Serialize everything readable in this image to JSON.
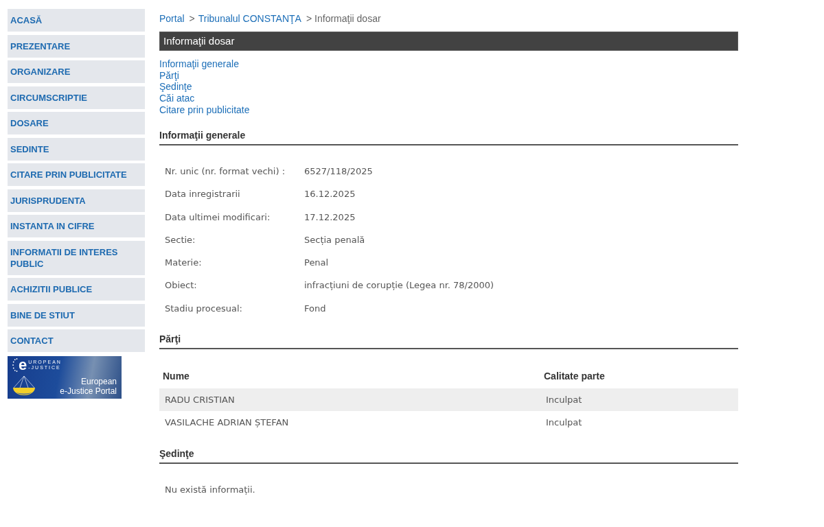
{
  "sidebar": {
    "items": [
      "ACASĂ",
      "PREZENTARE",
      "ORGANIZARE",
      "CIRCUMSCRIPTIE",
      "DOSARE",
      "SEDINTE",
      "CITARE PRIN PUBLICITATE",
      "JURISPRUDENTA",
      "INSTANTA IN CIFRE",
      "INFORMATII DE INTERES PUBLIC",
      "ACHIZITII PUBLICE",
      "BINE DE STIUT",
      "CONTACT"
    ],
    "banner": {
      "logo_letter": "e",
      "logo_top": "UROPEAN",
      "logo_bottom": "-JUSTICE",
      "caption": [
        "European",
        "e-Justice Portal"
      ]
    }
  },
  "breadcrumb": [
    {
      "label": "Portal",
      "link": true
    },
    {
      "separator": ">",
      "label": "Tribunalul CONSTANŢA",
      "link": true
    },
    {
      "separator": ">",
      "label": "Informaţii dosar",
      "link": false
    }
  ],
  "page_title": "Informaţii dosar",
  "section_links": [
    "Informaţii generale",
    "Părţi",
    "Şedinţe",
    "Căi atac",
    "Citare prin publicitate"
  ],
  "sections": [
    {
      "kind": "fields",
      "title": "Informaţii generale",
      "fields": [
        {
          "label": "Nr. unic (nr. format vechi) :",
          "value": "6527/118/2025"
        },
        {
          "label": "Data inregistrarii",
          "value": "16.12.2025"
        },
        {
          "label": "Data ultimei modificari:",
          "value": "17.12.2025"
        },
        {
          "label": "Sectie:",
          "value": "Secția penală"
        },
        {
          "label": "Materie:",
          "value": "Penal"
        },
        {
          "label": "Obiect:",
          "value": "infracțiuni de corupție (Legea nr. 78/2000)"
        },
        {
          "label": "Stadiu procesual:",
          "value": "Fond"
        }
      ]
    },
    {
      "kind": "table",
      "title": "Părţi",
      "columns": [
        "Nume",
        "Calitate parte"
      ],
      "rows": [
        [
          "RADU CRISTIAN",
          "Inculpat"
        ],
        [
          "VASILACHE ADRIAN ȘTEFAN",
          "Inculpat"
        ]
      ]
    },
    {
      "kind": "message",
      "title": "Şedinţe",
      "text": "Nu există informații."
    }
  ]
}
